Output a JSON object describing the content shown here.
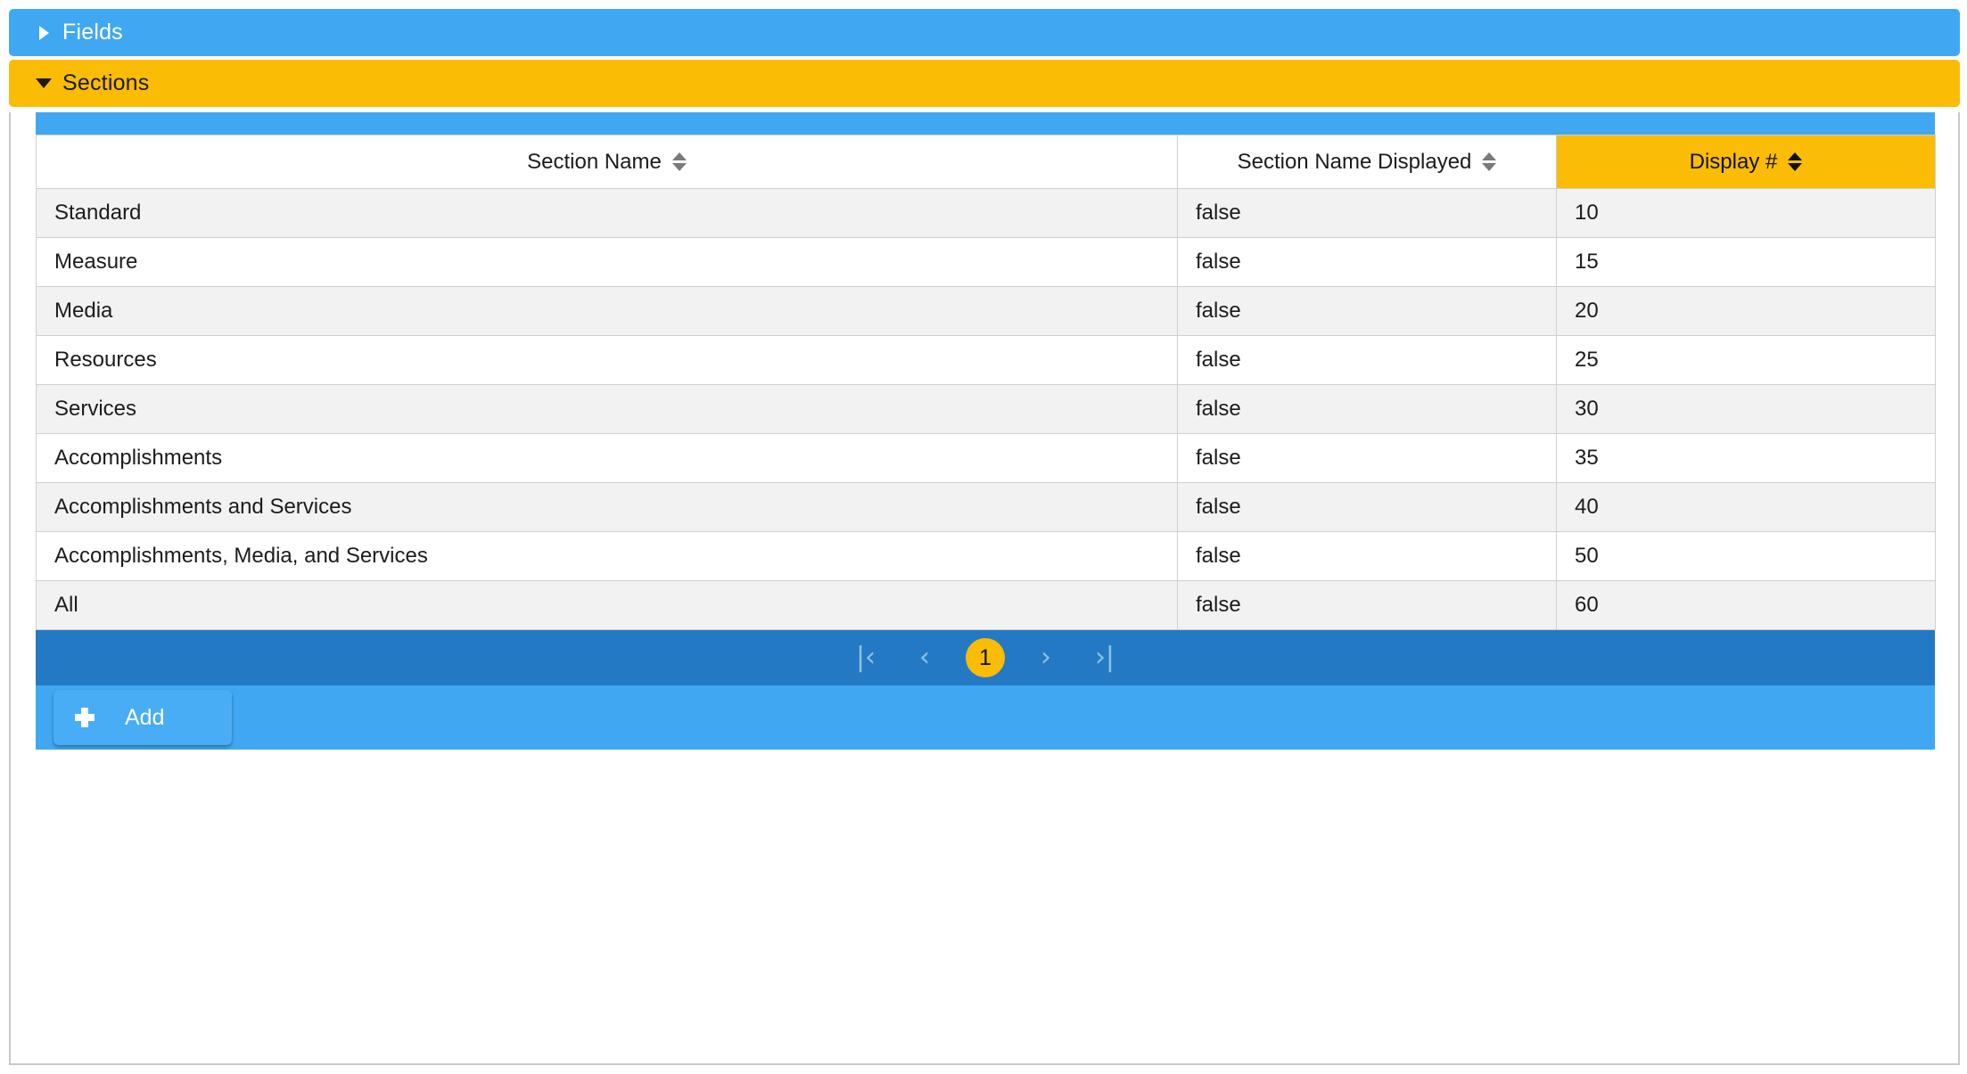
{
  "accordion": {
    "fields": {
      "label": "Fields",
      "expanded": false,
      "color": "#40a8f2"
    },
    "sections": {
      "label": "Sections",
      "expanded": true,
      "color": "#fabc05"
    }
  },
  "grid": {
    "columns": [
      {
        "label": "Section Name",
        "sorted": false,
        "sort_icon": "sort-updown-icon"
      },
      {
        "label": "Section Name Displayed",
        "sorted": false,
        "sort_icon": "sort-updown-icon"
      },
      {
        "label": "Display #",
        "sorted": true,
        "sort_icon": "sort-updown-icon"
      }
    ],
    "rows": [
      {
        "name": "Standard",
        "displayed": "false",
        "display_number": "10"
      },
      {
        "name": "Measure",
        "displayed": "false",
        "display_number": "15"
      },
      {
        "name": "Media",
        "displayed": "false",
        "display_number": "20"
      },
      {
        "name": "Resources",
        "displayed": "false",
        "display_number": "25"
      },
      {
        "name": "Services",
        "displayed": "false",
        "display_number": "30"
      },
      {
        "name": "Accomplishments",
        "displayed": "false",
        "display_number": "35"
      },
      {
        "name": "Accomplishments and Services",
        "displayed": "false",
        "display_number": "40"
      },
      {
        "name": "Accomplishments, Media, and Services",
        "displayed": "false",
        "display_number": "50"
      },
      {
        "name": "All",
        "displayed": "false",
        "display_number": "60"
      }
    ]
  },
  "pager": {
    "first_label": "|‹",
    "prev_label": "‹",
    "current_page": "1",
    "next_label": "›",
    "last_label": "›|",
    "active_color": "#fabc05",
    "bar_color": "#2479c4"
  },
  "footer": {
    "add_label": "Add",
    "add_icon": "plus-icon",
    "bar_color": "#40a8f2"
  }
}
